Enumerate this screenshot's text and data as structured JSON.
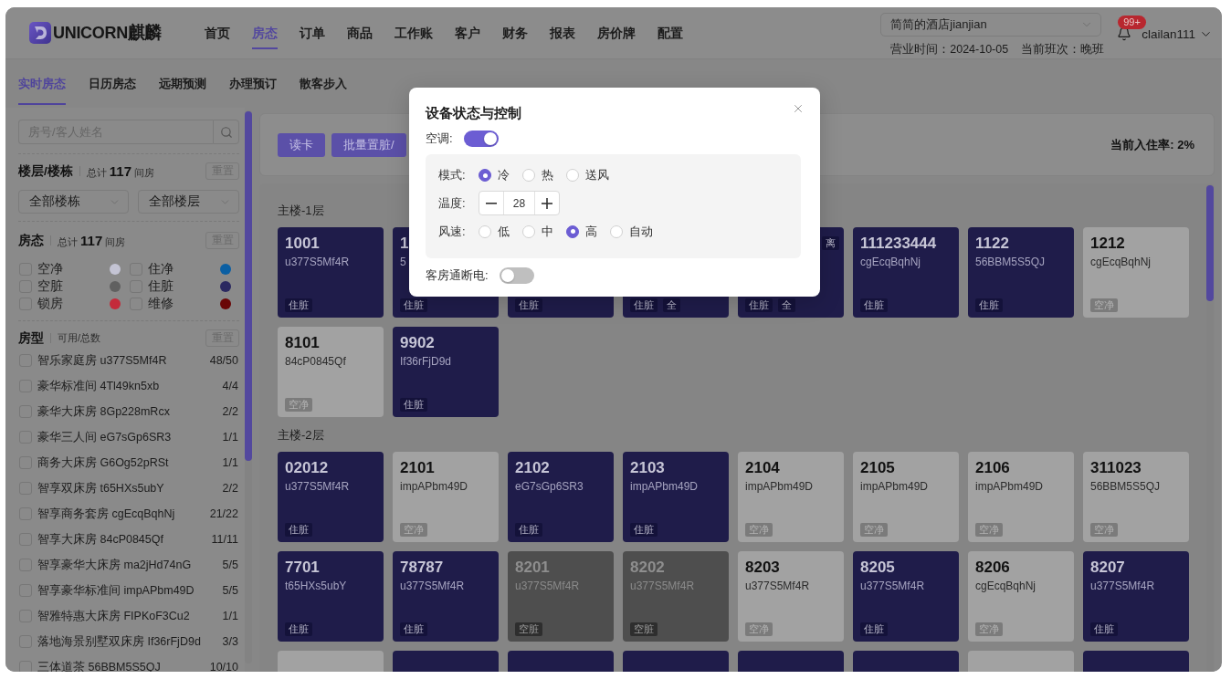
{
  "header": {
    "logo": {
      "wordmark": "UNICORN",
      "chinese": "麒麟"
    },
    "nav": [
      {
        "label": "首页",
        "selected": false
      },
      {
        "label": "房态",
        "selected": true
      },
      {
        "label": "订单",
        "selected": false
      },
      {
        "label": "商品",
        "selected": false
      },
      {
        "label": "工作账",
        "selected": false
      },
      {
        "label": "客户",
        "selected": false
      },
      {
        "label": "财务",
        "selected": false
      },
      {
        "label": "报表",
        "selected": false
      },
      {
        "label": "房价牌",
        "selected": false
      },
      {
        "label": "配置",
        "selected": false
      }
    ],
    "hotel_select": {
      "value": "简简的酒店jianjian"
    },
    "business_date": "营业时间：2024-10-05",
    "shift": "当前班次：晚班",
    "notification_badge": "99+",
    "user": "clailan111"
  },
  "subtabs": [
    {
      "label": "实时房态",
      "selected": true
    },
    {
      "label": "日历房态",
      "selected": false
    },
    {
      "label": "远期预测",
      "selected": false
    },
    {
      "label": "办理预订",
      "selected": false
    },
    {
      "label": "散客步入",
      "selected": false
    }
  ],
  "sidebar": {
    "search": {
      "placeholder": "房号/客人姓名"
    },
    "floor_filter": {
      "title": "楼层/楼栋",
      "total": "总计 **117** 间房",
      "reset": "重置",
      "selects": [
        {
          "value": "全部楼栋"
        },
        {
          "value": "全部楼层"
        }
      ]
    },
    "status_filter": {
      "title": "房态",
      "total": "总计 **117** 间房",
      "reset": "重置",
      "statuses": [
        {
          "label": "空净",
          "checked": false,
          "color": "#c4c4d4"
        },
        {
          "label": "住净",
          "checked": false,
          "color": "#0b5fa3"
        },
        {
          "label": "空脏",
          "checked": false,
          "color": "#606060"
        },
        {
          "label": "住脏",
          "checked": false,
          "color": "#2b2960"
        },
        {
          "label": "锁房",
          "checked": false,
          "color": "#c42a3a"
        },
        {
          "label": "维修",
          "checked": false,
          "color": "#6a0606"
        }
      ]
    },
    "room_types": {
      "title": "房型",
      "subtitle": "可用/总数",
      "reset": "重置",
      "items": [
        {
          "name": "智乐家庭房 u377S5Mf4R",
          "count": "48/50",
          "checked": false
        },
        {
          "name": "豪华标准间 4Tl49kn5xb",
          "count": "4/4",
          "checked": false
        },
        {
          "name": "豪华大床房 8Gp228mRcx",
          "count": "2/2",
          "checked": false
        },
        {
          "name": "豪华三人间 eG7sGp6SR3",
          "count": "1/1",
          "checked": false
        },
        {
          "name": "商务大床房 G6Og52pRSt",
          "count": "1/1",
          "checked": false
        },
        {
          "name": "智享双床房 t65HXs5ubY",
          "count": "2/2",
          "checked": false
        },
        {
          "name": "智享商务套房 cgEcqBqhNj",
          "count": "21/22",
          "checked": false
        },
        {
          "name": "智享大床房 84cP0845Qf",
          "count": "11/11",
          "checked": false
        },
        {
          "name": "智享豪华大床房 ma2jHd74nG",
          "count": "5/5",
          "checked": false
        },
        {
          "name": "智享豪华标准间 impAPbm49D",
          "count": "5/5",
          "checked": false
        },
        {
          "name": "智雅特惠大床房 FIPKoF3Cu2",
          "count": "1/1",
          "checked": false
        },
        {
          "name": "落地海景别墅双床房 If36rFjD9d",
          "count": "3/3",
          "checked": false
        },
        {
          "name": "三体道茶 56BBM5S5QJ",
          "count": "10/10",
          "checked": false
        }
      ]
    }
  },
  "toolbar": {
    "buttons": [
      {
        "label": "读卡"
      },
      {
        "label": "批量置脏/"
      }
    ],
    "occupancy": "当前入住率: 2%"
  },
  "floors": [
    {
      "title": "主楼-1层",
      "rooms": [
        {
          "number": "1001",
          "code": "u377S5Mf4R",
          "kind": "occupied_dirty",
          "tags": [
            "住脏"
          ]
        },
        {
          "number": "1",
          "code": "5",
          "kind": "occupied_dirty",
          "tags": [
            "住脏"
          ]
        },
        {
          "kind": "occupied_dirty",
          "tags": [
            "住脏"
          ]
        },
        {
          "kind": "occupied_dirty",
          "tags": [
            "住脏",
            "全"
          ]
        },
        {
          "kind": "occupied_dirty",
          "tags": [
            "住脏",
            "全"
          ],
          "corner": "离"
        },
        {
          "number": "111233444",
          "code": "cgEcqBqhNj",
          "kind": "occupied_dirty",
          "tags": [
            "住脏"
          ]
        },
        {
          "number": "1122",
          "code": "56BBM5S5QJ",
          "kind": "occupied_dirty",
          "tags": [
            "住脏"
          ]
        },
        {
          "number": "1212",
          "code": "cgEcqBqhNj",
          "kind": "vacant_clean",
          "tags": [
            "空净"
          ]
        },
        {
          "number": "8101",
          "code": "84cP0845Qf",
          "kind": "vacant_clean",
          "tags": [
            "空净"
          ]
        },
        {
          "number": "9902",
          "code": "If36rFjD9d",
          "kind": "occupied_dirty",
          "tags": [
            "住脏"
          ]
        }
      ]
    },
    {
      "title": "主楼-2层",
      "rooms": [
        {
          "number": "02012",
          "code": "u377S5Mf4R",
          "kind": "occupied_dirty",
          "tags": [
            "住脏"
          ]
        },
        {
          "number": "2101",
          "code": "impAPbm49D",
          "kind": "vacant_clean",
          "tags": [
            "空净"
          ]
        },
        {
          "number": "2102",
          "code": "eG7sGp6SR3",
          "kind": "occupied_dirty",
          "tags": [
            "住脏"
          ]
        },
        {
          "number": "2103",
          "code": "impAPbm49D",
          "kind": "occupied_dirty",
          "tags": [
            "住脏"
          ]
        },
        {
          "number": "2104",
          "code": "impAPbm49D",
          "kind": "vacant_clean",
          "tags": [
            "空净"
          ]
        },
        {
          "number": "2105",
          "code": "impAPbm49D",
          "kind": "vacant_clean",
          "tags": [
            "空净"
          ]
        },
        {
          "number": "2106",
          "code": "impAPbm49D",
          "kind": "vacant_clean",
          "tags": [
            "空净"
          ]
        },
        {
          "number": "311023",
          "code": "56BBM5S5QJ",
          "kind": "vacant_clean",
          "tags": [
            "空净"
          ]
        },
        {
          "number": "7701",
          "code": "t65HXs5ubY",
          "kind": "occupied_dirty",
          "tags": [
            "住脏"
          ]
        },
        {
          "number": "78787",
          "code": "u377S5Mf4R",
          "kind": "occupied_dirty",
          "tags": [
            "住脏"
          ]
        },
        {
          "number": "8201",
          "code": "u377S5Mf4R",
          "kind": "vacant_dirty",
          "tags": [
            "空脏"
          ]
        },
        {
          "number": "8202",
          "code": "u377S5Mf4R",
          "kind": "vacant_dirty",
          "tags": [
            "空脏"
          ]
        },
        {
          "number": "8203",
          "code": "u377S5Mf4R",
          "kind": "vacant_clean",
          "tags": [
            "空净"
          ]
        },
        {
          "number": "8205",
          "code": "u377S5Mf4R",
          "kind": "occupied_dirty",
          "tags": [
            "住脏"
          ]
        },
        {
          "number": "8206",
          "code": "cgEcqBqhNj",
          "kind": "vacant_clean",
          "tags": [
            "空净"
          ]
        },
        {
          "number": "8207",
          "code": "u377S5Mf4R",
          "kind": "occupied_dirty",
          "tags": [
            "住脏"
          ]
        },
        {
          "kind": "vacant_clean"
        },
        {
          "kind": "occupied_dirty"
        },
        {
          "kind": "occupied_dirty"
        },
        {
          "kind": "occupied_dirty"
        },
        {
          "kind": "occupied_dirty"
        },
        {
          "kind": "occupied_dirty"
        },
        {
          "kind": "vacant_clean"
        },
        {
          "kind": "occupied_dirty"
        }
      ]
    }
  ],
  "dialog": {
    "title": "设备状态与控制",
    "air_conditioner": {
      "label": "空调:",
      "on": true
    },
    "settings": {
      "mode": {
        "label": "模式:",
        "options": [
          {
            "label": "冷",
            "selected": true
          },
          {
            "label": "热",
            "selected": false
          },
          {
            "label": "送风",
            "selected": false
          }
        ]
      },
      "temperature": {
        "label": "温度:",
        "value": "28"
      },
      "fan_speed": {
        "label": "风速:",
        "options": [
          {
            "label": "低",
            "selected": false
          },
          {
            "label": "中",
            "selected": false
          },
          {
            "label": "高",
            "selected": true
          },
          {
            "label": "自动",
            "selected": false
          }
        ]
      }
    },
    "power": {
      "label": "客房通断电:",
      "on": false
    }
  }
}
